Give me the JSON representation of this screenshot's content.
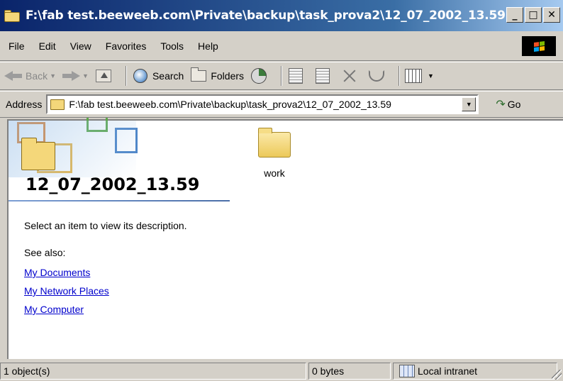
{
  "window": {
    "title": "F:\\fab test.beeweeb.com\\Private\\backup\\task_prova2\\12_07_2002_13.59",
    "controls": {
      "minimize": "_",
      "maximize": "□",
      "close": "✕"
    }
  },
  "menu": {
    "items": [
      "File",
      "Edit",
      "View",
      "Favorites",
      "Tools",
      "Help"
    ]
  },
  "toolbar": {
    "back_label": "Back",
    "search_label": "Search",
    "folders_label": "Folders"
  },
  "address": {
    "label": "Address",
    "value": "F:\\fab test.beeweeb.com\\Private\\backup\\task_prova2\\12_07_2002_13.59",
    "go_label": "Go"
  },
  "folder": {
    "title": "12_07_2002_13.59",
    "description": "Select an item to view its description.",
    "see_also_label": "See also:",
    "links": [
      "My Documents",
      "My Network Places",
      "My Computer"
    ]
  },
  "items": [
    {
      "name": "work",
      "icon": "folder-icon"
    }
  ],
  "status": {
    "objects": "1 object(s)",
    "size": "0 bytes",
    "zone": "Local intranet"
  },
  "colors": {
    "titlebar_start": "#0a246a",
    "titlebar_end": "#a6caf0",
    "link": "#0000cc",
    "chrome": "#d4d0c8"
  }
}
